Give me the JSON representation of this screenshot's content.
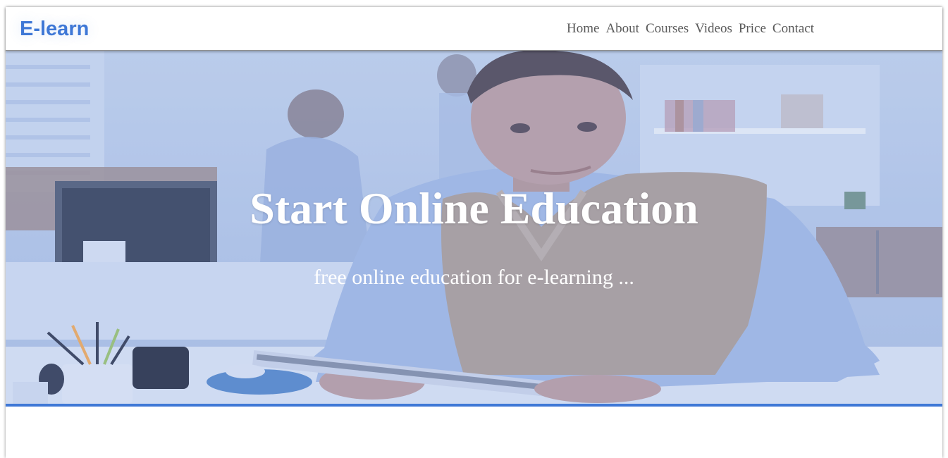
{
  "brand": {
    "name": "E-learn"
  },
  "nav": {
    "items": [
      "Home",
      "About",
      "Courses",
      "Videos",
      "Price",
      "Contact"
    ]
  },
  "hero": {
    "title": "Start Online Education",
    "subtitle": "free online education for e-learning ..."
  },
  "colors": {
    "accent": "#3f78d6",
    "nav_text": "#595959",
    "hero_text": "#ffffff"
  }
}
